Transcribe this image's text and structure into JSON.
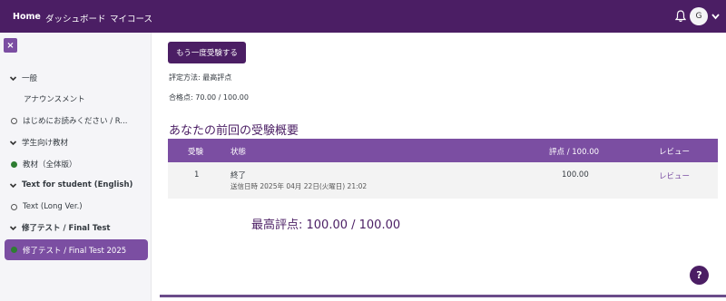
{
  "navbar": {
    "home": "Home",
    "dashboard": "ダッシュボード",
    "my_courses": "マイコース",
    "avatar_initial": "G"
  },
  "sidebar": {
    "close_label": "×",
    "items": [
      {
        "label": "一般"
      },
      {
        "label": "アナウンスメント"
      },
      {
        "label": "はじめにお読みください / R..."
      },
      {
        "label": "学生向け教材"
      },
      {
        "label": "教材（全体版）"
      },
      {
        "label": "Text for student (English)"
      },
      {
        "label": "Text (Long Ver.)"
      },
      {
        "label": "修了テスト / Final Test"
      },
      {
        "label": "修了テスト / Final Test 2025"
      }
    ]
  },
  "main": {
    "retake_button": "もう一度受験する",
    "grading_method": "評定方法: 最高評点",
    "passing_grade": "合格点: 70.00 / 100.00",
    "summary_title": "あなたの前回の受験概要",
    "table": {
      "headers": [
        "受験",
        "状態",
        "評点 / 100.00",
        "レビュー"
      ],
      "rows": [
        {
          "attempt": "1",
          "state": "終了",
          "submitted": "送信日時 2025年 04月 22日(火曜日) 21:02",
          "grade": "100.00",
          "review": "レビュー"
        }
      ]
    },
    "best_grade": "最高評点: 100.00 / 100.00"
  },
  "help": "?",
  "colors": {
    "navbar": "#4b1e64",
    "accent": "#7b4ea2",
    "complete_dot": "#2e7d32"
  }
}
